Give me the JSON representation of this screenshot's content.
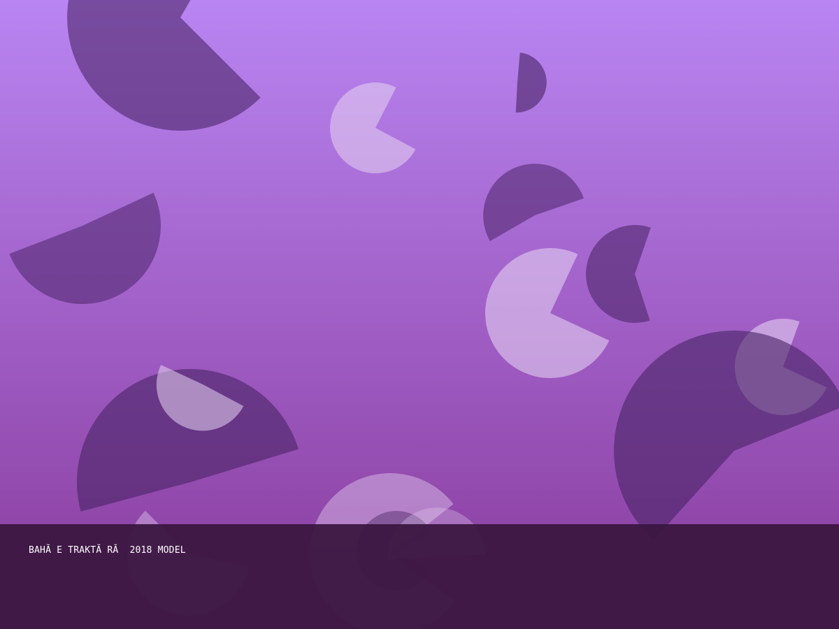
{
  "caption": "BAHĂ E TRAKTĂ RĂ  2018 MODEL",
  "colors": {
    "background_top": "#b985f2",
    "background_bottom": "#883a9b",
    "footer_band": "#3c1741",
    "caption_text": "#ffffff",
    "dark_shape": "#4b2567",
    "light_shape": "#e6d3f3"
  },
  "shape_count": 15
}
